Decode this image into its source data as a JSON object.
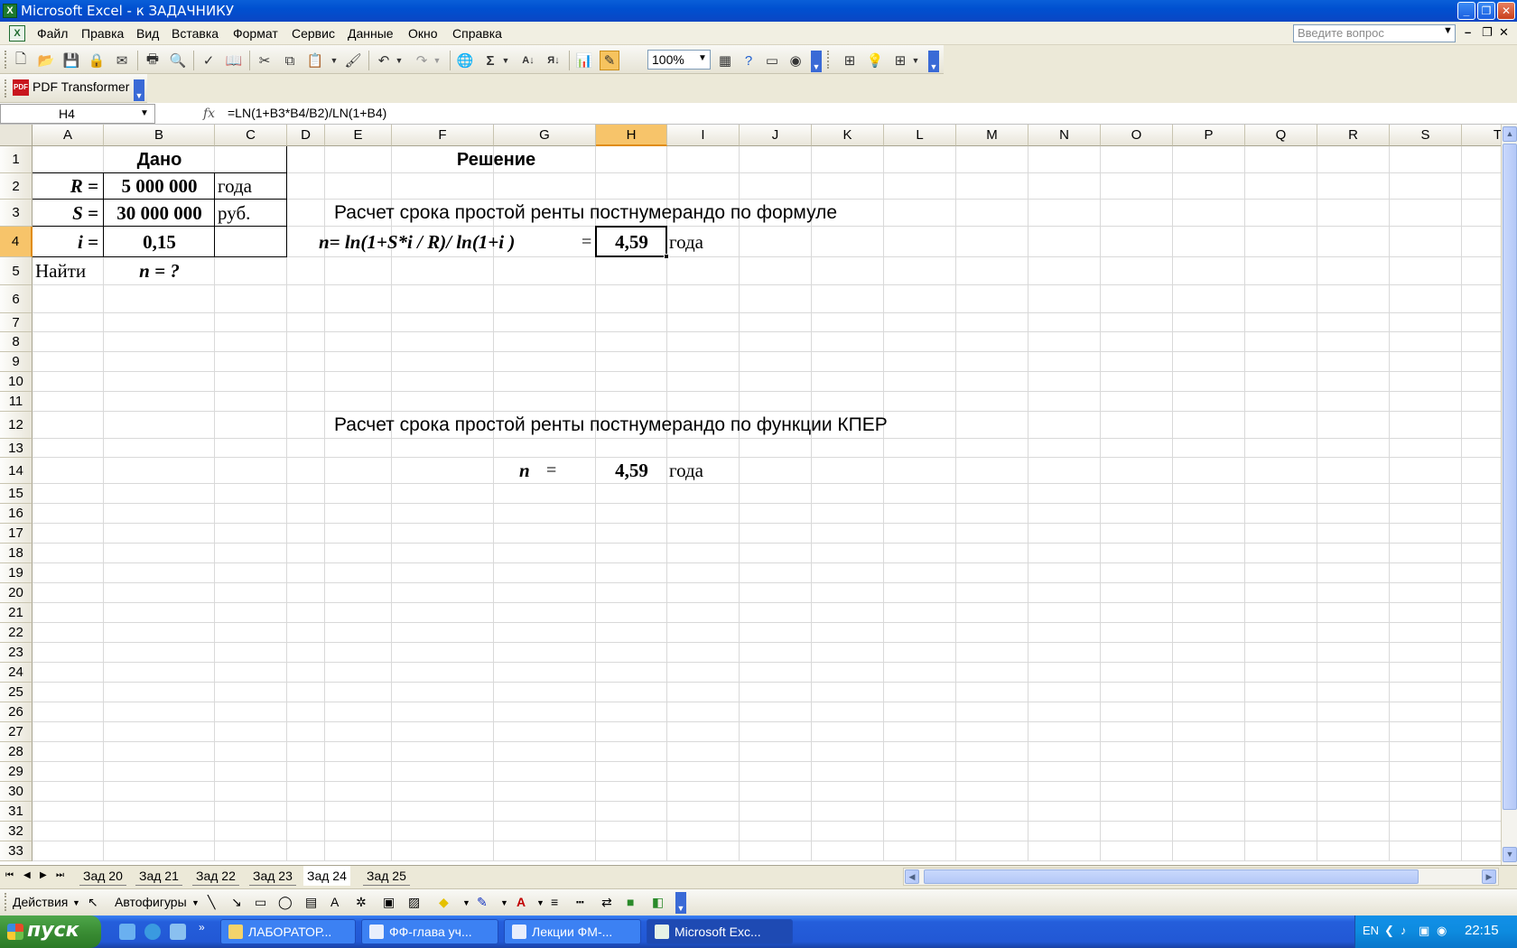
{
  "window": {
    "title": "Microsoft Excel - к ЗАДАЧНИКУ"
  },
  "menu": [
    "Файл",
    "Правка",
    "Вид",
    "Вставка",
    "Формат",
    "Сервис",
    "Данные",
    "Окно",
    "Справка"
  ],
  "ask_placeholder": "Введите вопрос",
  "toolbar": {
    "zoom": "100%",
    "pdf_label": "PDF Transformer"
  },
  "formula_bar": {
    "name_box": "H4",
    "formula": "=LN(1+B3*B4/B2)/LN(1+B4)"
  },
  "columns": [
    "A",
    "B",
    "C",
    "D",
    "E",
    "F",
    "G",
    "H",
    "I",
    "J",
    "K",
    "L",
    "M",
    "N",
    "O",
    "P",
    "Q",
    "R",
    "S",
    "T"
  ],
  "rows": [
    "1",
    "2",
    "3",
    "4",
    "5",
    "6",
    "7",
    "8",
    "9",
    "10",
    "11",
    "12",
    "13",
    "14",
    "15",
    "16",
    "17",
    "18",
    "19",
    "20",
    "21",
    "22",
    "23",
    "24",
    "25",
    "26",
    "27",
    "28",
    "29",
    "30",
    "31",
    "32",
    "33"
  ],
  "cells": {
    "b1": "Дано",
    "a2": "R =",
    "b2": "5 000 000",
    "c2": "года",
    "a3": "S =",
    "b3": "30 000 000",
    "c3": "руб.",
    "a4": "i =",
    "b4": "0,15",
    "a5": "Найти",
    "b5": "n = ?",
    "f1": "Решение",
    "e3": "Расчет срока простой ренты постнумерандо по формуле",
    "e4": "n= ln(1+S*i / R)/ ln(1+i )",
    "g4": "=",
    "h4": "4,59",
    "i4": "года",
    "e12": "Расчет срока простой ренты постнумерандо по функции КПЕР",
    "g14_label": "n",
    "g14_eq": "=",
    "h14": "4,59",
    "i14": "года"
  },
  "sheet_tabs": [
    "Зад 20",
    "Зад 21",
    "Зад 22",
    "Зад 23",
    "Зад 24",
    "Зад 25"
  ],
  "active_sheet": "Зад 24",
  "drawing_toolbar": {
    "actions": "Действия",
    "autoshapes": "Автофигуры"
  },
  "taskbar": {
    "start": "пуск",
    "tasks": [
      "ЛАБОРАТОР...",
      "ФФ-глава уч...",
      "Лекции ФМ-...",
      "Microsoft Exc..."
    ],
    "lang": "EN",
    "clock": "22:15"
  }
}
